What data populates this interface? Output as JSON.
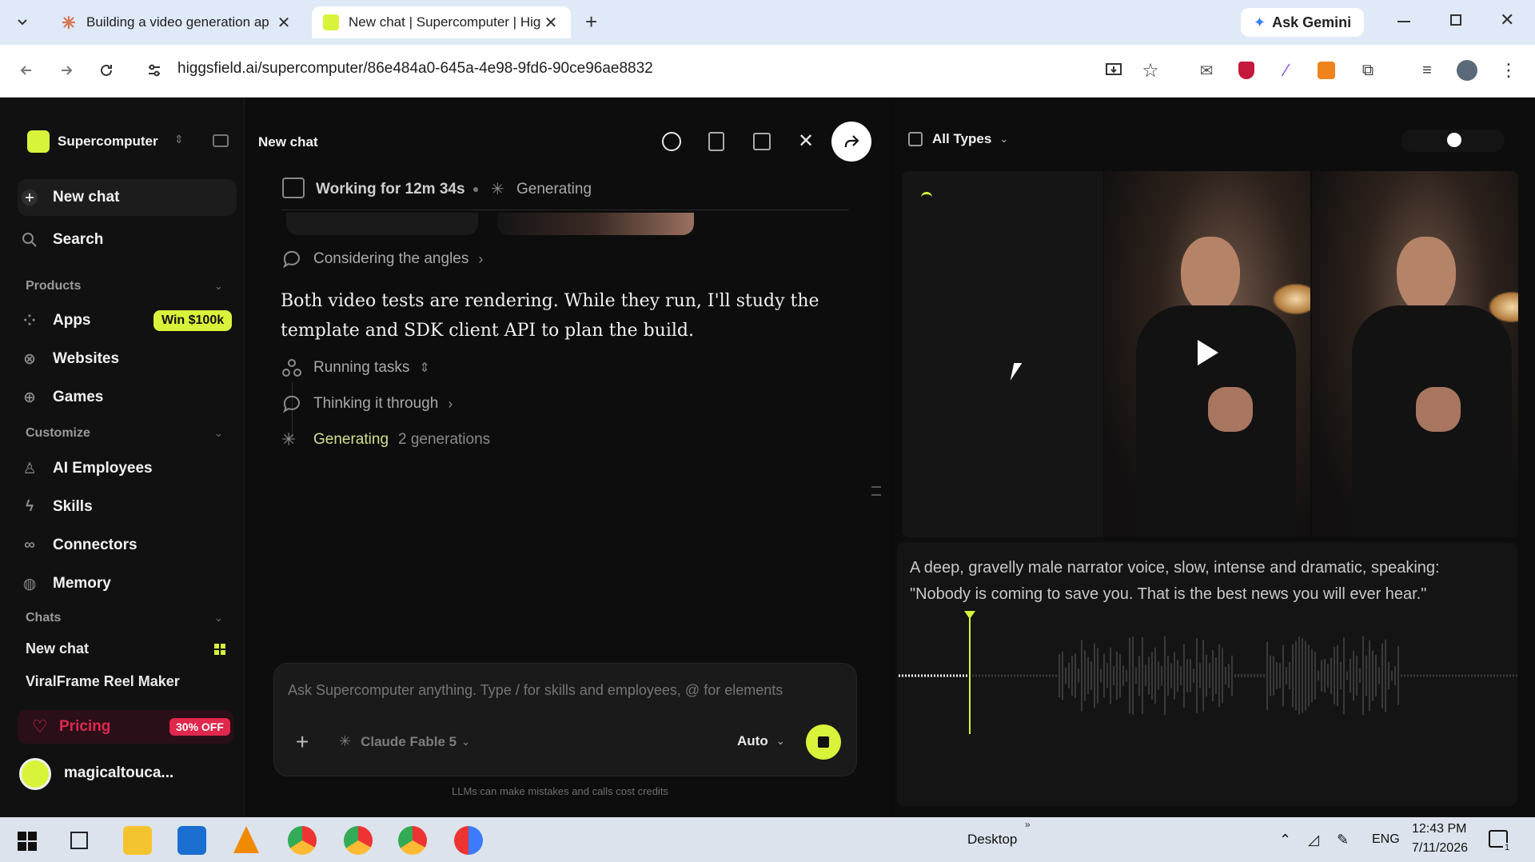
{
  "browser": {
    "tabs": [
      {
        "title": "Building a video generation ap",
        "active": false
      },
      {
        "title": "New chat | Supercomputer | Hig",
        "active": true
      }
    ],
    "ask_gemini": "Ask Gemini",
    "url": "higgsfield.ai/supercomputer/86e484a0-645a-4e98-9fd6-90ce96ae8832"
  },
  "sidebar": {
    "workspace": "Supercomputer",
    "new_chat": "New chat",
    "search": "Search",
    "products_label": "Products",
    "products": [
      {
        "label": "Apps",
        "badge": "Win $100k"
      },
      {
        "label": "Websites"
      },
      {
        "label": "Games"
      }
    ],
    "customize_label": "Customize",
    "customize": [
      {
        "label": "AI Employees"
      },
      {
        "label": "Skills"
      },
      {
        "label": "Connectors"
      },
      {
        "label": "Memory"
      }
    ],
    "chats_label": "Chats",
    "chats": [
      "New chat",
      "ViralFrame Reel Maker"
    ],
    "pricing": {
      "label": "Pricing",
      "badge": "30% OFF"
    },
    "username": "magicaltouca..."
  },
  "center": {
    "title": "New chat",
    "status_working": "Working for 12m 34s",
    "status_generating": "Generating",
    "considering": "Considering the angles",
    "message": "Both video tests are rendering. While they run, I'll study the template and SDK client API to plan the build.",
    "running_tasks": "Running tasks",
    "thinking": "Thinking it through",
    "generating_label": "Generating",
    "generating_count": "2 generations",
    "composer_placeholder": "Ask Supercomputer anything. Type / for skills and employees, @ for elements",
    "model": "Claude Fable 5",
    "mode": "Auto",
    "disclaimer": "LLMs can make mistakes and calls cost credits"
  },
  "right": {
    "filter": "All Types",
    "prompt_text": "A deep, gravelly male narrator voice, slow, intense and dramatic, speaking: \"Nobody is coming to save you. That is the best news you will ever hear.\""
  },
  "taskbar": {
    "desktop": "Desktop",
    "lang": "ENG",
    "time": "12:43 PM",
    "date": "7/11/2026",
    "notif_count": "1"
  },
  "colors": {
    "accent": "#d9f33a",
    "pricing_red": "#e0284d",
    "bg": "#0d0d0d"
  }
}
